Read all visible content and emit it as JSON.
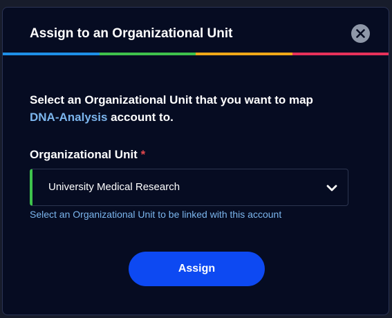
{
  "modal": {
    "title": "Assign to an Organizational Unit",
    "description_prefix": "Select an Organizational Unit that you want to map",
    "account_name": "DNA-Analysis",
    "description_suffix": " account to.",
    "field_label": "Organizational Unit",
    "required_marker": "*",
    "selected_value": "University Medical Research",
    "helper_text": "Select an Organizational Unit to be linked with this account",
    "assign_label": "Assign",
    "close_icon": "close-icon",
    "chevron_icon": "chevron-down-icon"
  },
  "colors": {
    "modal_bg": "#060c22",
    "accent_link": "#7cb6ee",
    "primary_button": "#0d49f2",
    "required": "#e5484d",
    "select_indicator": "#3ec24c",
    "rainbow": [
      "#1e8fe6",
      "#3ec24c",
      "#f0a818",
      "#e8315a"
    ]
  }
}
